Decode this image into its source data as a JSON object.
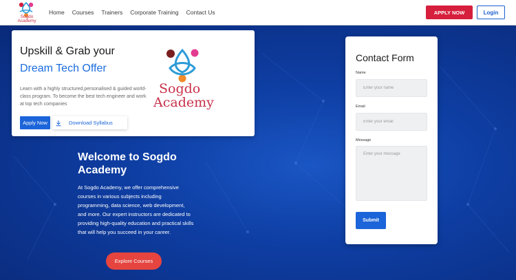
{
  "nav": {
    "logo_text": "Sogdo Academy",
    "links": [
      "Home",
      "Courses",
      "Trainers",
      "Corporate Training",
      "Contact Us"
    ],
    "apply_label": "APPLY NOW",
    "login_label": "Login"
  },
  "hero": {
    "title": "Upskill & Grab your",
    "subtitle": "Dream Tech Offer",
    "description": "Learn with a highly structured,personalised & guided world-class program. To become the best tech engineer and work at top tech companies",
    "apply_label": "Apply Now",
    "download_label": "Download Syllabus",
    "logo_line1": "Sogdo",
    "logo_line2": "Academy"
  },
  "welcome": {
    "title": "Welcome to Sogdo Academy",
    "description": "At Sogdo Academy, we offer comprehensive courses in various subjects including programming, data science, web development, and more. Our expert instructors are dedicated to providing high-quality education and practical skills that will help you succeed in your career.",
    "explore_label": "Explore Courses"
  },
  "contact": {
    "title": "Contact Form",
    "name_label": "Name",
    "name_placeholder": "Enter your name",
    "email_label": "Email",
    "email_placeholder": "Enter your email",
    "message_label": "Message",
    "message_placeholder": "Enter your message",
    "submit_label": "Submit"
  },
  "colors": {
    "brand_red": "#d61f3c",
    "brand_blue": "#1b64d9",
    "hero_bg": "#0e3ea3",
    "explore_red": "#e5443f"
  }
}
